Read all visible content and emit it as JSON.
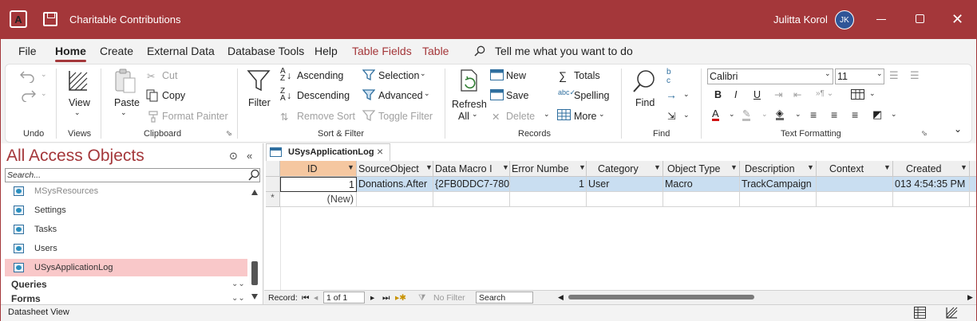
{
  "app": {
    "title": "Charitable Contributions",
    "user_name": "Julitta Korol",
    "user_initials": "JK"
  },
  "menu": {
    "tabs": [
      "File",
      "Home",
      "Create",
      "External Data",
      "Database Tools",
      "Help",
      "Table Fields",
      "Table"
    ],
    "active": "Home",
    "tell_me": "Tell me what you want to do"
  },
  "ribbon": {
    "undo_label": "Undo",
    "views": {
      "view": "View",
      "label": "Views"
    },
    "clipboard": {
      "paste": "Paste",
      "cut": "Cut",
      "copy": "Copy",
      "format_painter": "Format Painter",
      "label": "Clipboard"
    },
    "sort_filter": {
      "filter": "Filter",
      "ascending": "Ascending",
      "descending": "Descending",
      "remove_sort": "Remove Sort",
      "selection": "Selection",
      "advanced": "Advanced",
      "toggle_filter": "Toggle Filter",
      "label": "Sort & Filter"
    },
    "records": {
      "refresh": "Refresh",
      "all": "All",
      "new": "New",
      "save": "Save",
      "delete": "Delete",
      "totals": "Totals",
      "spelling": "Spelling",
      "more": "More",
      "label": "Records"
    },
    "find": {
      "find": "Find",
      "label": "Find"
    },
    "text_formatting": {
      "font": "Calibri",
      "size": "11",
      "bold": "B",
      "italic": "I",
      "underline": "U",
      "label": "Text Formatting"
    }
  },
  "nav": {
    "title": "All Access Objects",
    "search_placeholder": "Search...",
    "items": [
      {
        "label": "MSysResources"
      },
      {
        "label": "Settings"
      },
      {
        "label": "Tasks"
      },
      {
        "label": "Users"
      },
      {
        "label": "USysApplicationLog"
      }
    ],
    "sections": [
      "Queries",
      "Forms"
    ]
  },
  "doc_tab": {
    "label": "USysApplicationLog"
  },
  "grid": {
    "columns": [
      "ID",
      "SourceObject",
      "Data Macro I",
      "Error Numbe",
      "Category",
      "Object Type",
      "Description",
      "Context",
      "Created"
    ],
    "rows": [
      {
        "id": "1",
        "source_object": "Donations.After",
        "data_macro": "{2FB0DDC7-780",
        "error_number": "1",
        "category": "User",
        "object_type": "Macro",
        "description": "TrackCampaign",
        "context": "",
        "created": "013 4:54:35 PM"
      }
    ],
    "new_row_label": "(New)",
    "new_row_marker": "*"
  },
  "record_nav": {
    "record_label": "Record:",
    "position": "1 of 1",
    "no_filter": "No Filter",
    "search": "Search"
  },
  "status": {
    "text": "Datasheet View"
  },
  "colors": {
    "accent": "#a4373a",
    "selected_row": "#c9def1",
    "nav_selected": "#f9c8c9"
  }
}
